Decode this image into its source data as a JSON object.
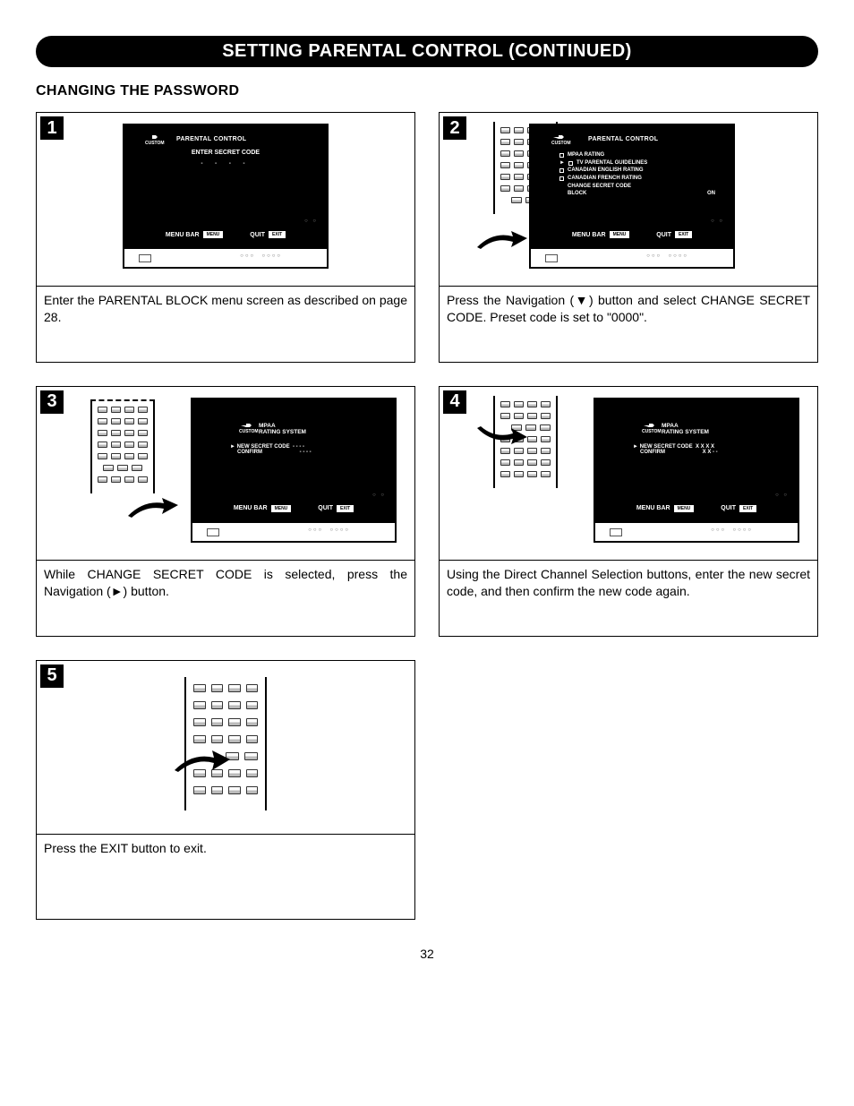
{
  "header": {
    "title": "SETTING PARENTAL CONTROL (CONTINUED)"
  },
  "subheading": "CHANGING THE PASSWORD",
  "labels": {
    "custom": "CUSTOM",
    "menuBar": "MENU BAR",
    "menu": "MENU",
    "quit": "QUIT",
    "exit": "EXIT",
    "on": "ON"
  },
  "steps": [
    {
      "num": "1",
      "caption": "Enter the PARENTAL BLOCK menu screen as described on page 28.",
      "screen": {
        "title": "PARENTAL CONTROL",
        "sub": "ENTER SECRET CODE",
        "dots": "-  -  -  -"
      }
    },
    {
      "num": "2",
      "caption": "Press the Navigation (▼) button and select CHANGE SECRET CODE. Preset code is set to \"0000\".",
      "screen": {
        "title": "PARENTAL CONTROL",
        "items": [
          "MPAA RATING",
          "TV PARENTAL GUIDELINES",
          "CANADIAN ENGLISH RATING",
          "CANADIAN FRENCH RATING",
          "CHANGE SECRET CODE",
          "BLOCK"
        ]
      }
    },
    {
      "num": "3",
      "caption": "While CHANGE SECRET CODE is selected, press the Navigation (►) button.",
      "screen": {
        "line1": "MPAA",
        "line2": "RATING SYSTEM",
        "r1l": "NEW SECRET CODE",
        "r1v": "-   -   -   -",
        "r2l": "CONFIRM",
        "r2v": "-   -   -   -"
      }
    },
    {
      "num": "4",
      "caption": "Using the Direct Channel Selection buttons, enter the new secret code, and then confirm the new code again.",
      "screen": {
        "line1": "MPAA",
        "line2": "RATING SYSTEM",
        "r1l": "NEW SECRET CODE",
        "r1v": "X   X   X   X",
        "r2l": "CONFIRM",
        "r2v": "X   X   -   -"
      }
    },
    {
      "num": "5",
      "caption": "Press the EXIT button to exit."
    }
  ],
  "pageNumber": "32"
}
